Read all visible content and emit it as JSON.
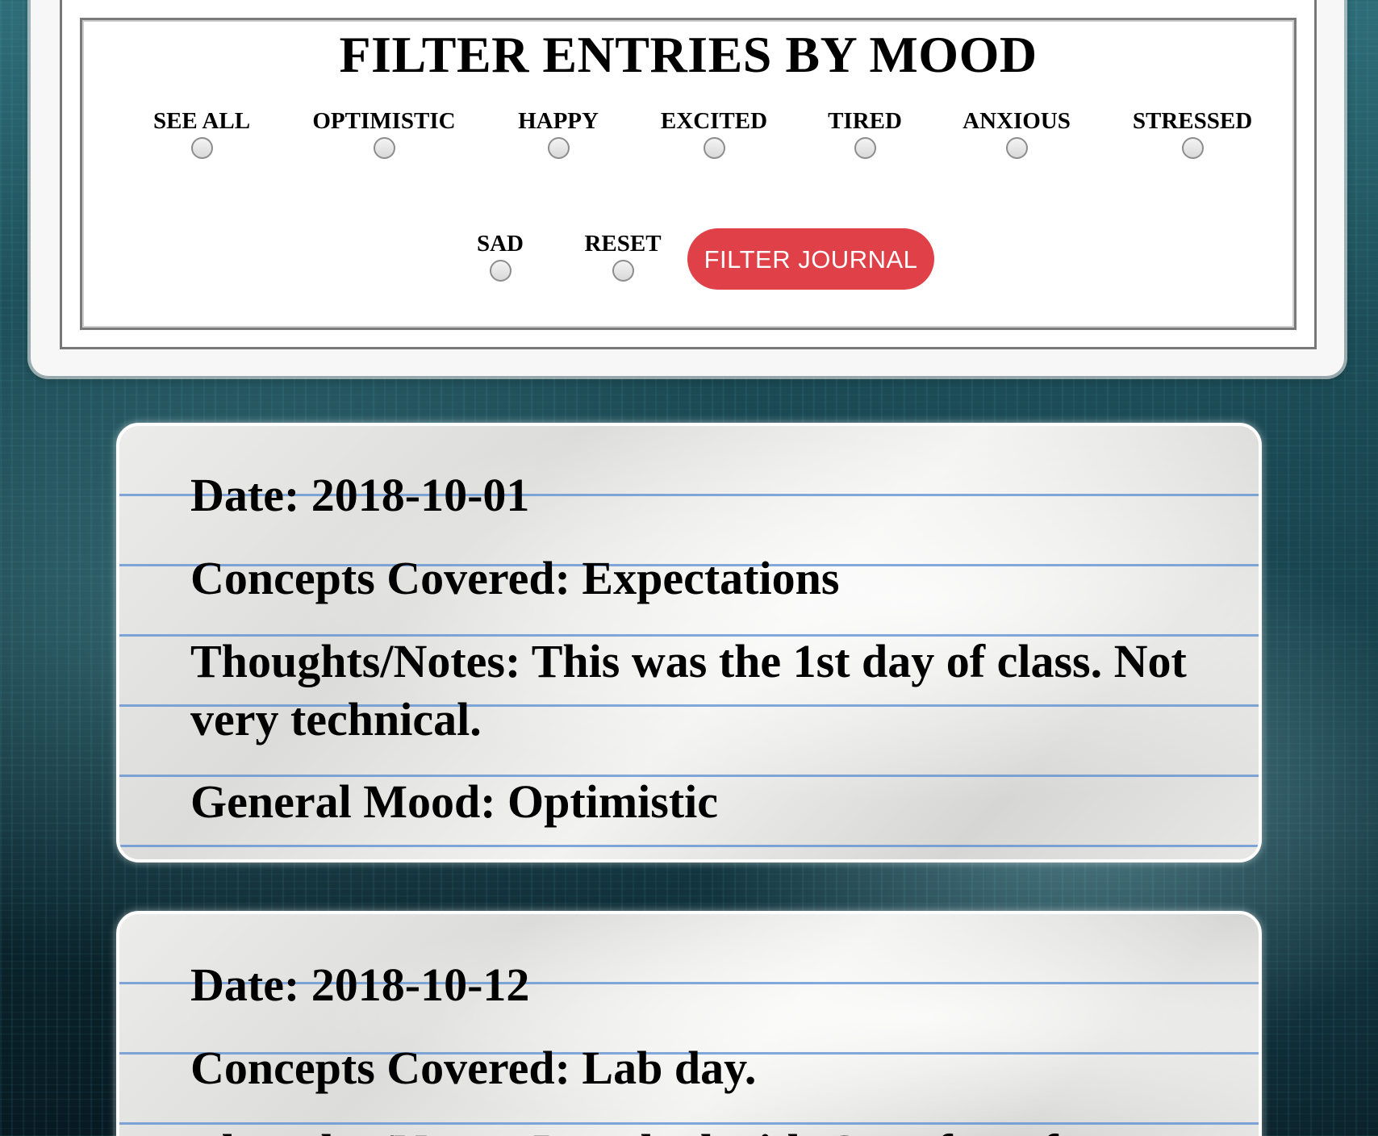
{
  "filter": {
    "title": "FILTER ENTRIES BY MOOD",
    "options": [
      {
        "label": "SEE ALL"
      },
      {
        "label": "OPTIMISTIC"
      },
      {
        "label": "HAPPY"
      },
      {
        "label": "EXCITED"
      },
      {
        "label": "TIRED"
      },
      {
        "label": "ANXIOUS"
      },
      {
        "label": "STRESSED"
      },
      {
        "label": "SAD"
      },
      {
        "label": "RESET"
      }
    ],
    "button_label": "FILTER JOURNAL",
    "button_color": "#e04048"
  },
  "entries": [
    {
      "date": "Date: 2018-10-01",
      "concepts": "Concepts Covered: Expectations",
      "notes": "Thoughts/Notes: This was the 1st day of class. Not very technical.",
      "mood": "General Mood: Optimistic"
    },
    {
      "date": "Date: 2018-10-12",
      "concepts": "Concepts Covered: Lab day.",
      "notes": "Thoughts/Notes: I worked with Greg for a fe"
    }
  ]
}
